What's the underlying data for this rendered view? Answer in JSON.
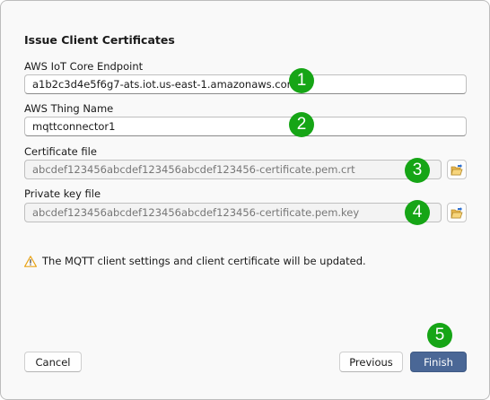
{
  "dialog": {
    "title": "Issue Client Certificates",
    "endpoint": {
      "label": "AWS IoT Core Endpoint",
      "value": "a1b2c3d4e5f6g7-ats.iot.us-east-1.amazonaws.com",
      "badge": "1"
    },
    "thing_name": {
      "label": "AWS Thing Name",
      "value": "mqttconnector1",
      "badge": "2"
    },
    "certificate_file": {
      "label": "Certificate file",
      "value": "abcdef123456abcdef123456abcdef123456-certificate.pem.crt",
      "badge": "3",
      "browse_icon": "folder-open-icon"
    },
    "private_key_file": {
      "label": "Private key file",
      "value": "abcdef123456abcdef123456abcdef123456-certificate.pem.key",
      "badge": "4",
      "browse_icon": "folder-open-icon"
    },
    "warning": {
      "icon": "warning-icon",
      "text": "The MQTT client settings and client certificate will be updated."
    },
    "buttons": {
      "cancel": "Cancel",
      "previous": "Previous",
      "finish": "Finish",
      "finish_badge": "5"
    }
  },
  "colors": {
    "badge": "#16a516",
    "primary_button": "#4a6796",
    "warning_icon": "#e8a317"
  }
}
